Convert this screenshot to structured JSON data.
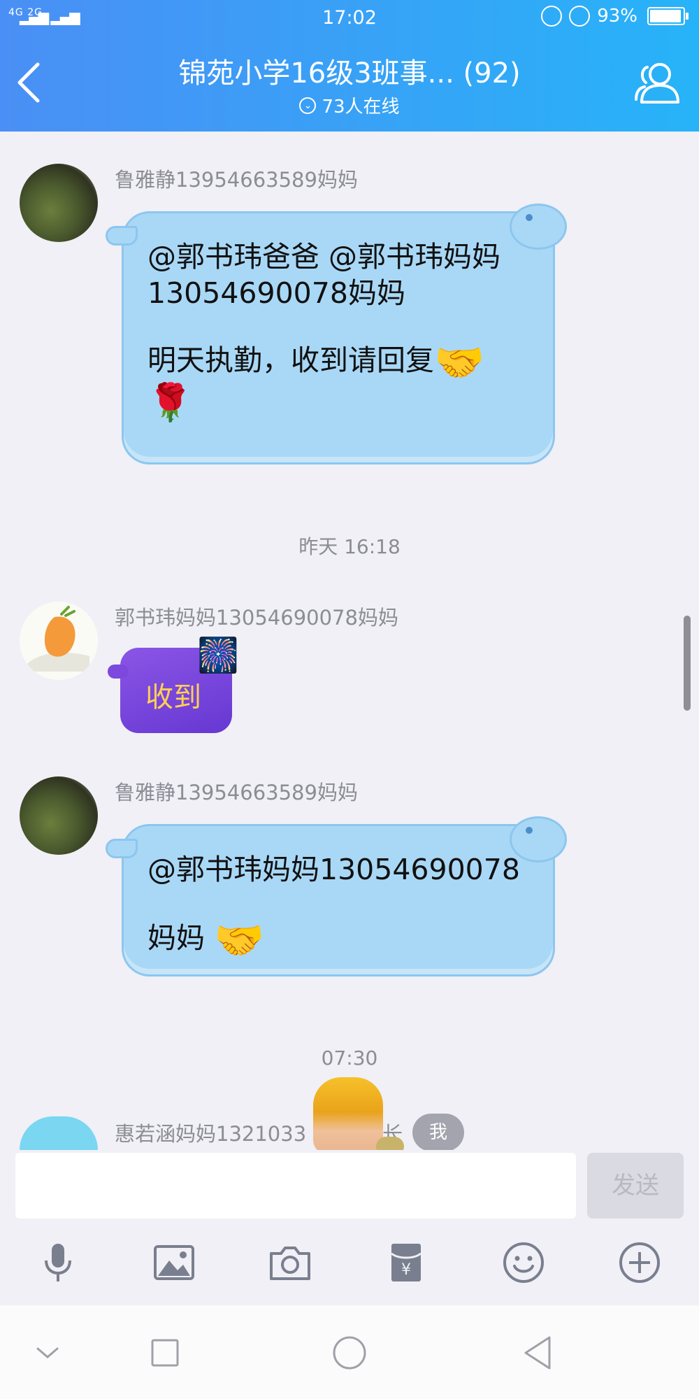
{
  "status_bar": {
    "network": "4G 2G",
    "time": "17:02",
    "battery": "93%"
  },
  "header": {
    "title": "锦苑小学16级3班事... (92)",
    "online": "73人在线"
  },
  "messages": [
    {
      "sender": "鲁雅静13954663589妈妈",
      "line1": "@郭书玮爸爸 @郭书玮妈妈",
      "line2": "13054690078妈妈",
      "line3": "明天执勤，收到请回复",
      "emoji_hand": "🤝",
      "emoji_rose": "🌹"
    },
    {
      "timestamp": "昨天 16:18",
      "sender": "郭书玮妈妈13054690078妈妈",
      "text": "收到",
      "emoji": "🎆"
    },
    {
      "sender": "鲁雅静13954663589妈妈",
      "line1": "@郭书玮妈妈13054690078",
      "line2": "妈妈",
      "emoji_hand": "🤝"
    },
    {
      "timestamp": "07:30",
      "sender": "惠若涵妈妈1321033",
      "sender_suffix": "家长",
      "badge": "我"
    }
  ],
  "input": {
    "value": "",
    "send_label": "发送"
  },
  "toolbar": {
    "icons": [
      "microphone-icon",
      "image-icon",
      "camera-icon",
      "red-packet-icon",
      "emoji-icon",
      "plus-icon"
    ]
  },
  "navbar": {
    "icons": [
      "chevron-down-icon",
      "square-icon",
      "circle-icon",
      "triangle-back-icon"
    ]
  }
}
